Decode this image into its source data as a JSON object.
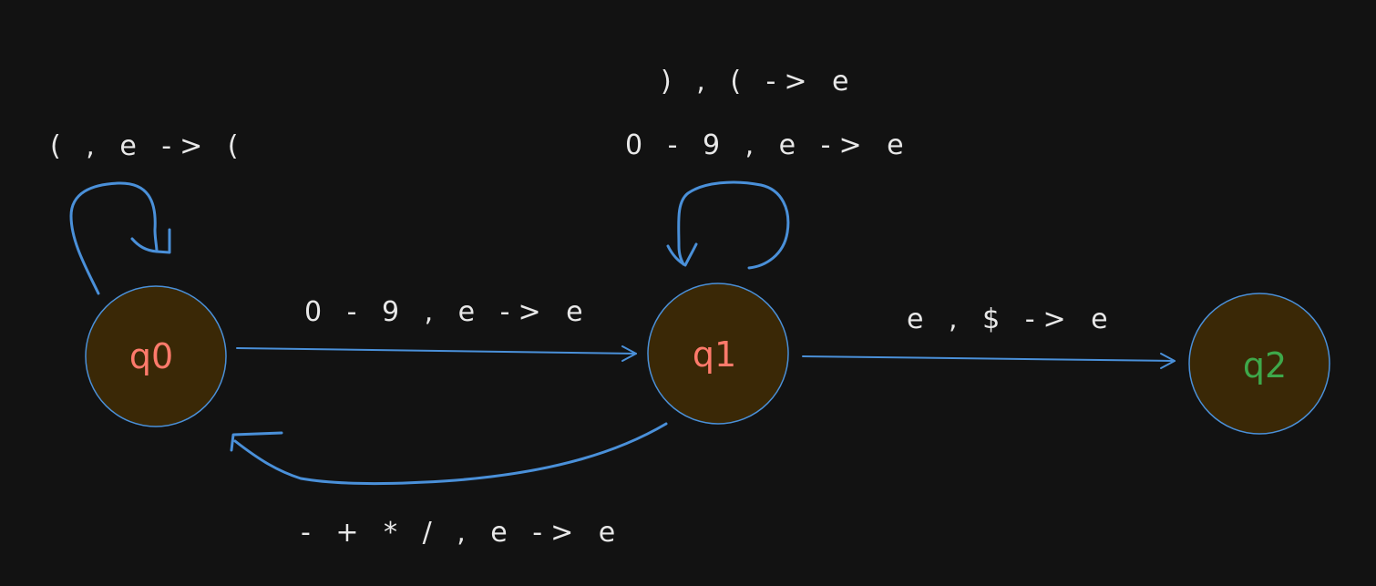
{
  "states": [
    {
      "id": "q0",
      "label": "q0",
      "color": "#ff7a6b"
    },
    {
      "id": "q1",
      "label": "q1",
      "color": "#ff7a6b"
    },
    {
      "id": "q2",
      "label": "q2",
      "color": "#3ea84a"
    }
  ],
  "transitions": {
    "q0_loop": "( , e -> (",
    "q1_loop_top": ") , ( -> e",
    "q1_loop_bottom": "0 - 9 , e -> e",
    "q0_to_q1": "0 - 9 , e -> e",
    "q1_to_q2": "e , $ -> e",
    "q1_to_q0": "- + * / , e -> e"
  },
  "colors": {
    "background": "#121212",
    "edge": "#4a90d9",
    "state_fill": "#3a2806",
    "text": "#e8e8e8"
  }
}
